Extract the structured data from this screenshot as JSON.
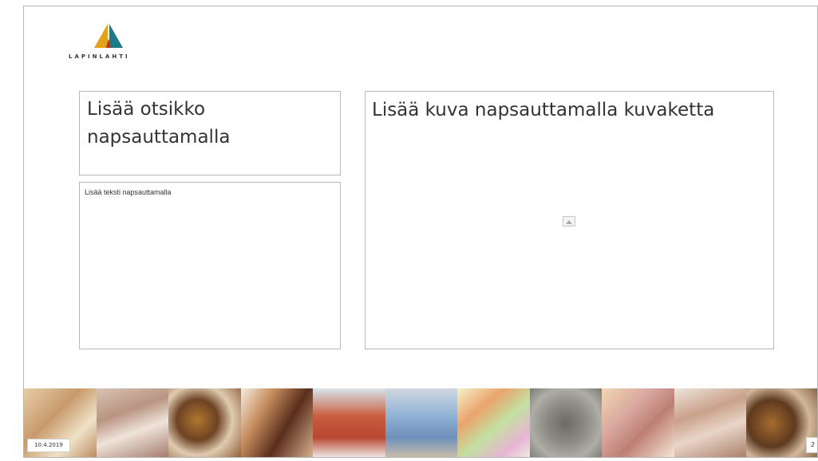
{
  "logo": {
    "text": "LAPINLAHTI",
    "colors": {
      "left": "#e3a21a",
      "right": "#1e7a86",
      "center": "#b2381f"
    }
  },
  "title_placeholder": {
    "text": "Lisää otsikko napsauttamalla"
  },
  "text_placeholder": {
    "text": "Lisää teksti napsauttamalla"
  },
  "picture_placeholder": {
    "text": "Lisää kuva napsauttamalla kuvaketta",
    "icon": "picture-icon"
  },
  "footer": {
    "date": "10.4.2019",
    "slide_number": "2"
  }
}
